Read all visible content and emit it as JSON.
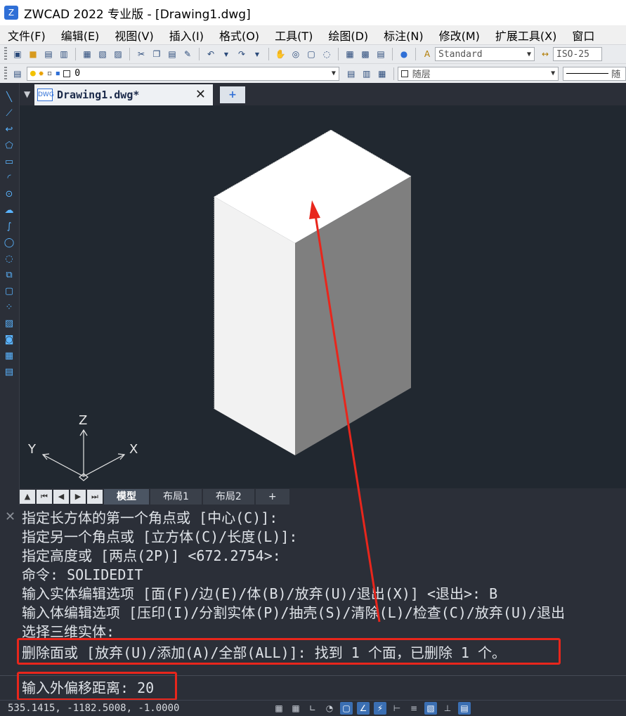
{
  "app": {
    "title": "ZWCAD 2022 专业版 - [Drawing1.dwg]",
    "logo_glyph": "Z"
  },
  "menu": [
    "文件(F)",
    "编辑(E)",
    "视图(V)",
    "插入(I)",
    "格式(O)",
    "工具(T)",
    "绘图(D)",
    "标注(N)",
    "修改(M)",
    "扩展工具(X)",
    "窗口"
  ],
  "toolbar1": {
    "text_style": "Standard",
    "dim_style": "ISO-25"
  },
  "toolbar2": {
    "layer_name": "0",
    "color": "随层",
    "linetype": "随"
  },
  "document_tab": {
    "name": "Drawing1.dwg*",
    "close_glyph": "✕",
    "new_glyph": "+"
  },
  "ucs": {
    "x_label": "X",
    "y_label": "Y",
    "z_label": "Z"
  },
  "layout_tabs": [
    {
      "label": "模型",
      "active": true
    },
    {
      "label": "布局1",
      "active": false
    },
    {
      "label": "布局2",
      "active": false
    },
    {
      "label": "+",
      "active": false
    }
  ],
  "command_history": [
    "指定长方体的第一个角点或 [中心(C)]:",
    "指定另一个角点或 [立方体(C)/长度(L)]:",
    "指定高度或 [两点(2P)] <672.2754>:",
    "命令: SOLIDEDIT",
    "输入实体编辑选项 [面(F)/边(E)/体(B)/放弃(U)/退出(X)] <退出>: B",
    "输入体编辑选项 [压印(I)/分割实体(P)/抽壳(S)/清除(L)/检查(C)/放弃(U)/退出",
    "选择三维实体:",
    "删除面或 [放弃(U)/添加(A)/全部(ALL)]: 找到 1 个面，已删除 1 个。"
  ],
  "command_input": "输入外偏移距离: 20",
  "status": {
    "coordinates": "535.1415, -1182.5008, -1.0000"
  },
  "colors": {
    "canvas_bg": "#212830",
    "ui_dark": "#2b2f38",
    "annotation_red": "#e8261c",
    "box_top": "#ffffff",
    "box_left": "#f2f2f2",
    "box_right": "#7f7f7f"
  }
}
